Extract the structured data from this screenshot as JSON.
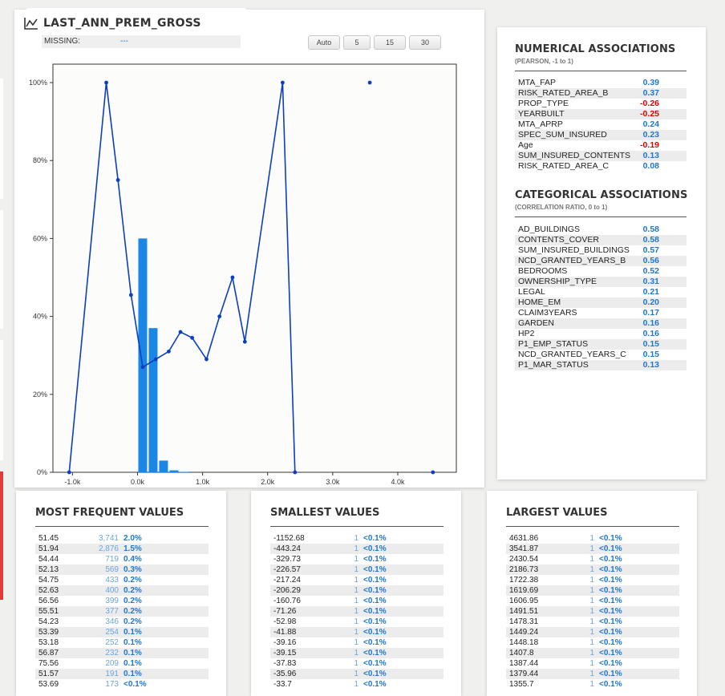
{
  "header": {
    "title": "LAST_ANN_PREM_GROSS",
    "missing_label": "MISSING:",
    "missing_value": "---",
    "bin_buttons": [
      "Auto",
      "5",
      "15",
      "30"
    ]
  },
  "colors": {
    "bar": "#1a86e6",
    "line": "#0b3fbf",
    "positive": "#1f77d0",
    "negative": "#e00000"
  },
  "chart_data": {
    "type": "bar",
    "xlim": [
      -1300,
      4900
    ],
    "ylim": [
      0,
      100
    ],
    "x_ticks": [
      -1000,
      0,
      1000,
      2000,
      3000,
      4000
    ],
    "x_tick_labels": [
      "-1.0k",
      "0.0k",
      "1.0k",
      "2.0k",
      "3.0k",
      "4.0k"
    ],
    "y_ticks": [
      0,
      20,
      40,
      60,
      80,
      100
    ],
    "y_tick_labels": [
      "0%",
      "20%",
      "40%",
      "60%",
      "80%",
      "100%"
    ],
    "grid": false,
    "bars": {
      "bin_width": 160,
      "x": [
        0,
        160,
        320,
        480,
        640
      ],
      "values": [
        60,
        37,
        3,
        0.5,
        0.1
      ]
    },
    "line": {
      "x": [
        -1050,
        -480,
        -300,
        -100,
        80,
        280,
        480,
        660,
        840,
        1060,
        1260,
        1460,
        1650,
        2230,
        2420
      ],
      "y": [
        0,
        100,
        75,
        45.5,
        27,
        29,
        31,
        36,
        34.5,
        29,
        40,
        50,
        33.5,
        100,
        0
      ]
    },
    "points": {
      "x": [
        3570,
        4540
      ],
      "y": [
        100,
        0
      ]
    }
  },
  "numerical": {
    "title": "NUMERICAL ASSOCIATIONS",
    "subtitle": "(PEARSON, -1 to 1)",
    "rows": [
      {
        "name": "MTA_FAP",
        "value": "0.39"
      },
      {
        "name": "RISK_RATED_AREA_B",
        "value": "0.37"
      },
      {
        "name": "PROP_TYPE",
        "value": "-0.26"
      },
      {
        "name": "YEARBUILT",
        "value": "-0.25"
      },
      {
        "name": "MTA_APRP",
        "value": "0.24"
      },
      {
        "name": "SPEC_SUM_INSURED",
        "value": "0.23"
      },
      {
        "name": "Age",
        "value": "-0.19"
      },
      {
        "name": "SUM_INSURED_CONTENTS",
        "value": "0.13"
      },
      {
        "name": "RISK_RATED_AREA_C",
        "value": "0.08"
      }
    ]
  },
  "categorical": {
    "title": "CATEGORICAL ASSOCIATIONS",
    "subtitle": "(CORRELATION RATIO, 0 to 1)",
    "rows": [
      {
        "name": "AD_BUILDINGS",
        "value": "0.58"
      },
      {
        "name": "CONTENTS_COVER",
        "value": "0.58"
      },
      {
        "name": "SUM_INSURED_BUILDINGS",
        "value": "0.57"
      },
      {
        "name": "NCD_GRANTED_YEARS_B",
        "value": "0.56"
      },
      {
        "name": "BEDROOMS",
        "value": "0.52"
      },
      {
        "name": "OWNERSHIP_TYPE",
        "value": "0.31"
      },
      {
        "name": "LEGAL",
        "value": "0.21"
      },
      {
        "name": "HOME_EM",
        "value": "0.20"
      },
      {
        "name": "CLAIM3YEARS",
        "value": "0.17"
      },
      {
        "name": "GARDEN",
        "value": "0.16"
      },
      {
        "name": "HP2",
        "value": "0.16"
      },
      {
        "name": "P1_EMP_STATUS",
        "value": "0.15"
      },
      {
        "name": "NCD_GRANTED_YEARS_C",
        "value": "0.15"
      },
      {
        "name": "P1_MAR_STATUS",
        "value": "0.13"
      }
    ]
  },
  "most_frequent": {
    "title": "MOST FREQUENT VALUES",
    "rows": [
      {
        "value": "51.45",
        "count": "3,741",
        "pct": "2.0%"
      },
      {
        "value": "51.94",
        "count": "2,876",
        "pct": "1.5%"
      },
      {
        "value": "54.44",
        "count": "719",
        "pct": "0.4%"
      },
      {
        "value": "52.13",
        "count": "569",
        "pct": "0.3%"
      },
      {
        "value": "54.75",
        "count": "433",
        "pct": "0.2%"
      },
      {
        "value": "52.63",
        "count": "400",
        "pct": "0.2%"
      },
      {
        "value": "56.56",
        "count": "399",
        "pct": "0.2%"
      },
      {
        "value": "55.51",
        "count": "377",
        "pct": "0.2%"
      },
      {
        "value": "54.23",
        "count": "346",
        "pct": "0.2%"
      },
      {
        "value": "53.39",
        "count": "254",
        "pct": "0.1%"
      },
      {
        "value": "53.18",
        "count": "252",
        "pct": "0.1%"
      },
      {
        "value": "56.87",
        "count": "232",
        "pct": "0.1%"
      },
      {
        "value": "75.56",
        "count": "209",
        "pct": "0.1%"
      },
      {
        "value": "51.57",
        "count": "191",
        "pct": "0.1%"
      },
      {
        "value": "53.69",
        "count": "173",
        "pct": "<0.1%"
      }
    ]
  },
  "smallest": {
    "title": "SMALLEST VALUES",
    "rows": [
      {
        "value": "-1152.68",
        "count": "1",
        "pct": "<0.1%"
      },
      {
        "value": "-443.24",
        "count": "1",
        "pct": "<0.1%"
      },
      {
        "value": "-329.73",
        "count": "1",
        "pct": "<0.1%"
      },
      {
        "value": "-226.57",
        "count": "1",
        "pct": "<0.1%"
      },
      {
        "value": "-217.24",
        "count": "1",
        "pct": "<0.1%"
      },
      {
        "value": "-206.29",
        "count": "1",
        "pct": "<0.1%"
      },
      {
        "value": "-160.76",
        "count": "1",
        "pct": "<0.1%"
      },
      {
        "value": "-71.26",
        "count": "1",
        "pct": "<0.1%"
      },
      {
        "value": "-52.98",
        "count": "1",
        "pct": "<0.1%"
      },
      {
        "value": "-41.88",
        "count": "1",
        "pct": "<0.1%"
      },
      {
        "value": "-39.16",
        "count": "1",
        "pct": "<0.1%"
      },
      {
        "value": "-39.15",
        "count": "1",
        "pct": "<0.1%"
      },
      {
        "value": "-37.83",
        "count": "1",
        "pct": "<0.1%"
      },
      {
        "value": "-35.96",
        "count": "1",
        "pct": "<0.1%"
      },
      {
        "value": "-33.7",
        "count": "1",
        "pct": "<0.1%"
      }
    ]
  },
  "largest": {
    "title": "LARGEST VALUES",
    "rows": [
      {
        "value": "4631.86",
        "count": "1",
        "pct": "<0.1%"
      },
      {
        "value": "3541.87",
        "count": "1",
        "pct": "<0.1%"
      },
      {
        "value": "2430.54",
        "count": "1",
        "pct": "<0.1%"
      },
      {
        "value": "2186.73",
        "count": "1",
        "pct": "<0.1%"
      },
      {
        "value": "1722.38",
        "count": "1",
        "pct": "<0.1%"
      },
      {
        "value": "1619.69",
        "count": "1",
        "pct": "<0.1%"
      },
      {
        "value": "1606.95",
        "count": "1",
        "pct": "<0.1%"
      },
      {
        "value": "1491.51",
        "count": "1",
        "pct": "<0.1%"
      },
      {
        "value": "1478.31",
        "count": "1",
        "pct": "<0.1%"
      },
      {
        "value": "1449.24",
        "count": "1",
        "pct": "<0.1%"
      },
      {
        "value": "1448.18",
        "count": "1",
        "pct": "<0.1%"
      },
      {
        "value": "1407.8",
        "count": "1",
        "pct": "<0.1%"
      },
      {
        "value": "1387.44",
        "count": "1",
        "pct": "<0.1%"
      },
      {
        "value": "1379.44",
        "count": "1",
        "pct": "<0.1%"
      },
      {
        "value": "1355.7",
        "count": "1",
        "pct": "<0.1%"
      }
    ]
  }
}
